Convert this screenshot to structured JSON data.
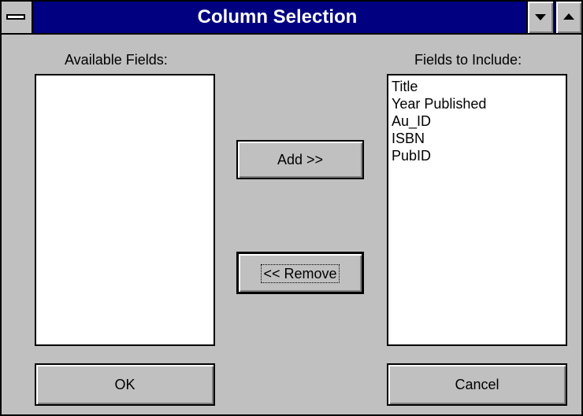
{
  "window": {
    "title": "Column Selection",
    "controls": {
      "system_menu_icon": "system-menu-icon",
      "minimize_icon": "minimize-triangle-icon",
      "maximize_icon": "maximize-triangle-icon"
    }
  },
  "available": {
    "label": "Available Fields:",
    "items": []
  },
  "include": {
    "label": "Fields to Include:",
    "items": [
      "Title",
      "Year Published",
      "Au_ID",
      "ISBN",
      "PubID"
    ]
  },
  "buttons": {
    "add": "Add >>",
    "remove": "<< Remove",
    "ok": "OK",
    "cancel": "Cancel"
  },
  "colors": {
    "titlebar": "#000080",
    "face": "#c0c0c0",
    "list_bg": "#ffffff"
  }
}
